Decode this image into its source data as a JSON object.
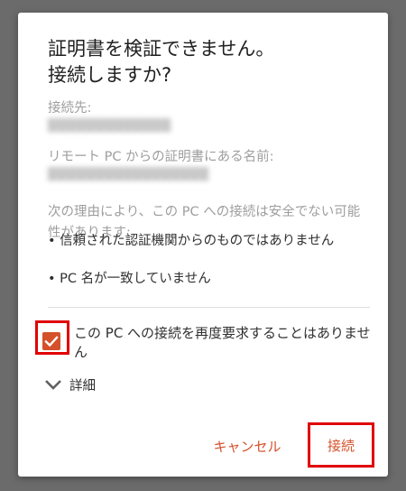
{
  "dialog": {
    "title_line1": "証明書を検証できません。",
    "title_line2": "接続しますか?",
    "destination_label": "接続先:",
    "destination_value": "█████████████",
    "cert_name_label": "リモート PC からの証明書にある名前:",
    "cert_name_value": "█████████████████",
    "reason_text": "次の理由により、この PC への接続は安全でない可能性があります:",
    "bullet1": "• 信頼された認証機関からのものではありません",
    "bullet2": "• PC 名が一致していません",
    "checkbox_label": "この PC への接続を再度要求することはありません",
    "checkbox_checked": true,
    "details_label": "詳細",
    "cancel_label": "キャンセル",
    "connect_label": "接続",
    "accent_color": "#d4512b"
  }
}
